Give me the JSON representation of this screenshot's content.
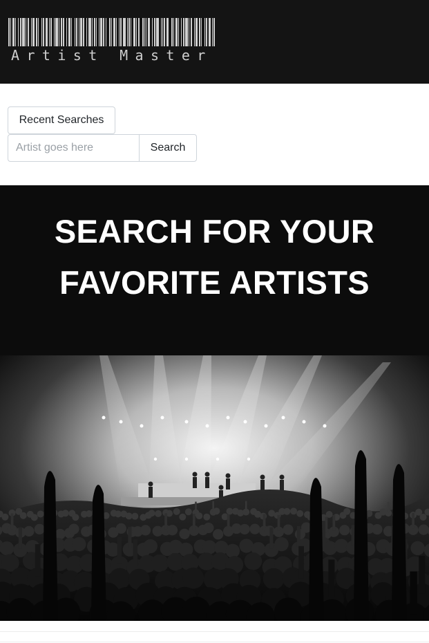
{
  "header": {
    "logo_text": "Artist Master",
    "logo_icon": "barcode-icon"
  },
  "search": {
    "recent_label": "Recent Searches",
    "placeholder": "Artist goes here",
    "value": "",
    "search_label": "Search"
  },
  "hero": {
    "title_line1": "SEARCH FOR YOUR",
    "title_line2": "FAVORITE ARTISTS"
  },
  "colors": {
    "header_bg": "#141414",
    "hero_bg": "#0c0c0c",
    "button_border": "#ced4da"
  }
}
